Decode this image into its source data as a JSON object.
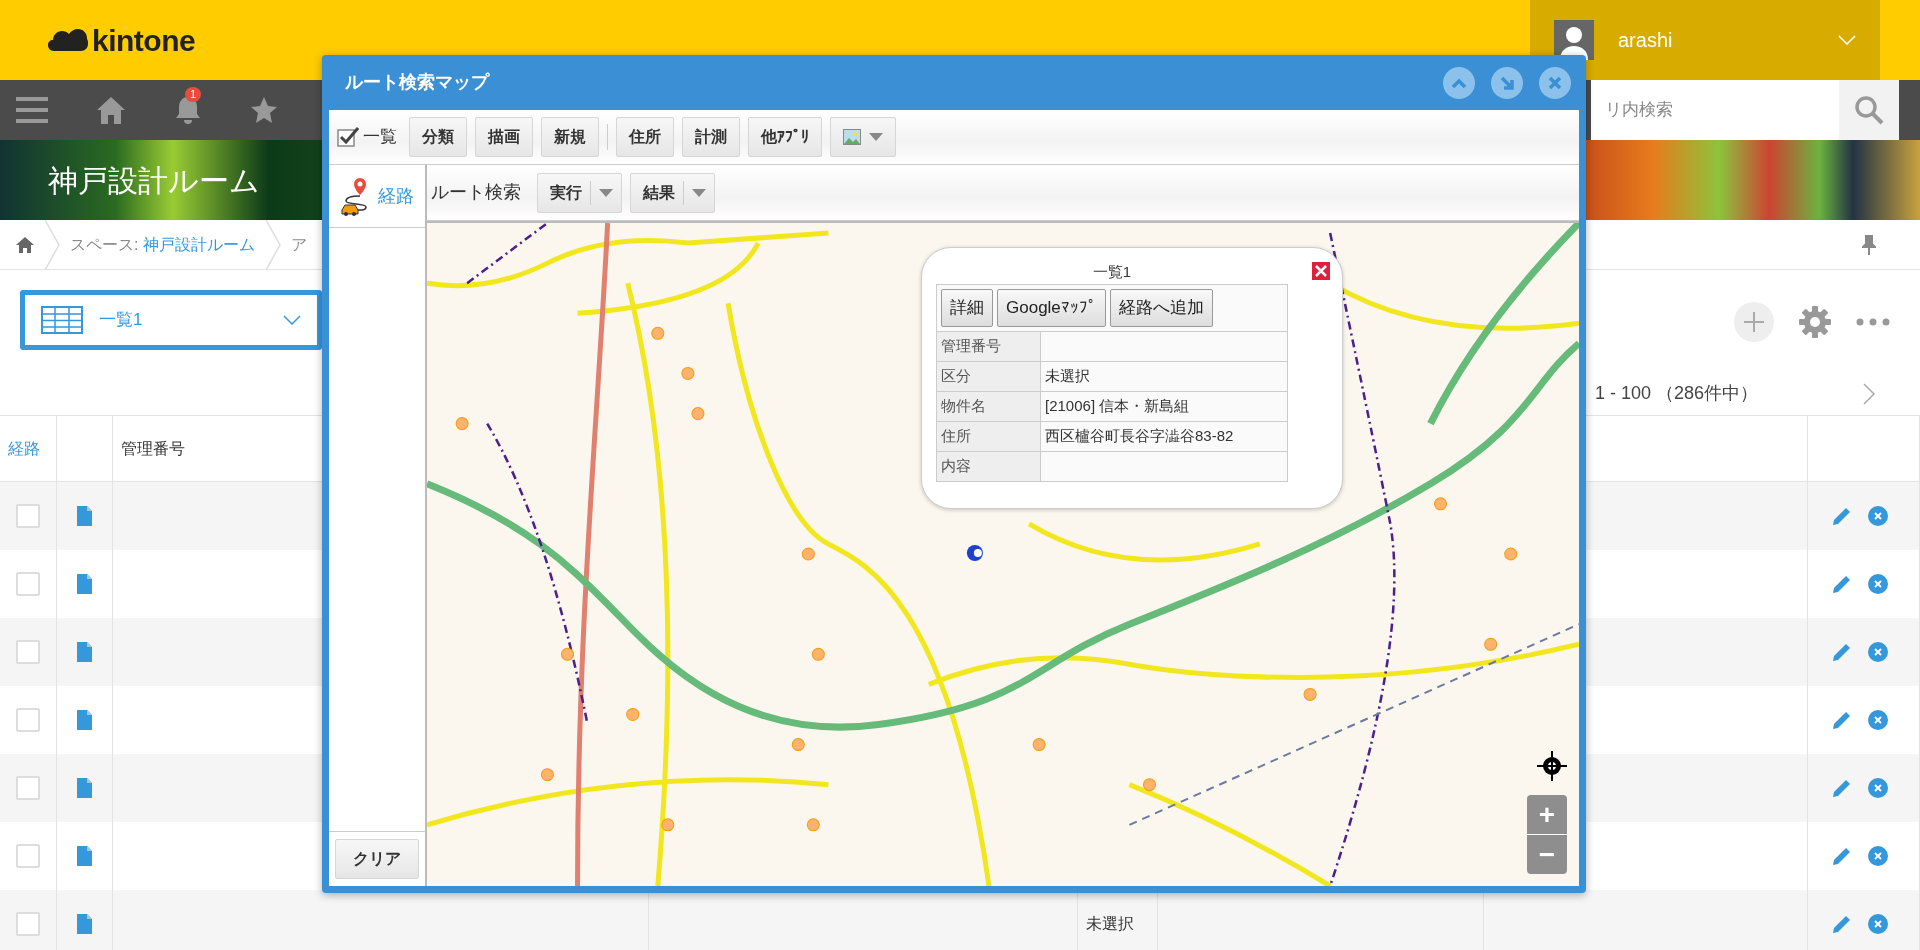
{
  "header": {
    "logo": "kintone",
    "user": {
      "name": "arashi"
    }
  },
  "navbar": {
    "notification_count": "1",
    "search": {
      "placeholder": "リ内検索"
    }
  },
  "space": {
    "title": "神戸設計ルーム"
  },
  "breadcrumb": {
    "space_label": "スペース: ",
    "space_link": "神戸設計ルーム",
    "next": "ア"
  },
  "view_selector": {
    "label": "一覧1"
  },
  "pagination": {
    "range": "1 - 100 （286件中）"
  },
  "table": {
    "columns": [
      "経路",
      "管理番号"
    ],
    "rows": [
      {
        "checked": false
      },
      {
        "checked": false
      },
      {
        "checked": false
      },
      {
        "checked": false
      },
      {
        "checked": false
      },
      {
        "checked": false
      },
      {
        "checked": false,
        "column_5": "未選択"
      }
    ]
  },
  "modal": {
    "title": "ルート検索マップ",
    "toolbar": {
      "list_toggle": {
        "label": "一覧",
        "checked": true
      },
      "groups": [
        [
          {
            "kind": "button",
            "label": "分類"
          },
          {
            "kind": "button",
            "label": "描画"
          },
          {
            "kind": "button",
            "label": "新規"
          }
        ],
        [
          {
            "kind": "button",
            "label": "住所"
          },
          {
            "kind": "button",
            "label": "計測"
          },
          {
            "kind": "button",
            "label": "他ｱﾌﾟﾘ"
          },
          {
            "kind": "image-dropdown"
          }
        ]
      ]
    },
    "sidebar": {
      "tabs": [
        {
          "label": "経路",
          "selected": true
        }
      ],
      "clear_button": "クリア"
    },
    "route_toolbar": {
      "label": "ルート検索",
      "buttons": [
        "実行",
        "結果"
      ]
    },
    "popup": {
      "title": "一覧1",
      "buttons": [
        "詳細",
        "Googleﾏｯﾌﾟ",
        "経路へ追加"
      ],
      "fields": [
        {
          "label": "管理番号"
        },
        {
          "label": "区分",
          "value": "未選択"
        },
        {
          "label": "物件名",
          "value": "[21006] 信本・新島組"
        },
        {
          "label": "住所",
          "value": "西区櫨谷町長谷字澁谷83-82"
        },
        {
          "label": "内容"
        }
      ]
    },
    "map_controls": {
      "zoom_in": "+",
      "zoom_out": "−"
    }
  }
}
